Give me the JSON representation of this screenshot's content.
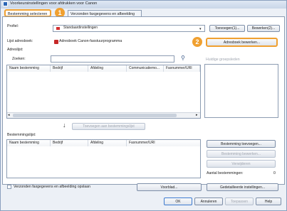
{
  "window": {
    "title": "Voorkeursinstellingen voor afdrukken voor Canon"
  },
  "tabs": [
    {
      "label": "Bestemming selecteren"
    },
    {
      "label": "Verzonden faxgegevens en afbeelding"
    }
  ],
  "callouts": {
    "one": "1",
    "two": "2"
  },
  "profile": {
    "label": "Profiel:",
    "value": "Standaardinstellingen",
    "add_button": "Toevoegen(1)...",
    "edit_button": "Bewerken(2)..."
  },
  "addressbook": {
    "list_label": "Lijst adresboek:",
    "value": "Adresboek Canon-faxstuurprogramma",
    "edit_button": "Adresboek bewerken...",
    "address_list_label": "Adreslijst:",
    "search_label": "Zoeken:",
    "search_value": "",
    "groups_label": "Huidige groepsleden"
  },
  "address_columns": [
    "Naam bestemming",
    "Bedrijf",
    "Afdeling",
    "Communicatiemo...",
    "Faxnummer/URI"
  ],
  "add_to_list_button": "Toevoegen aan bestemmingslijst",
  "destlist": {
    "label": "Bestemmingslijst:",
    "columns": [
      "Naam bestemming",
      "Bedrijf",
      "Afdeling",
      "Faxnummer/URI"
    ]
  },
  "right_buttons": {
    "add": "Bestemming toevoegen...",
    "edit": "Bestemming bewerken...",
    "delete": "Verwijderen"
  },
  "count": {
    "label": "Aantal bestemmingen:",
    "value": "0"
  },
  "save_checkbox_label": "Verzonden faxgegevens en afbeelding opslaan",
  "preview_button": "Voorblad...",
  "detail_button": "Gedetailleerde instellingen...",
  "footer": {
    "ok": "OK",
    "cancel": "Annuleren",
    "apply": "Toepassen",
    "help": "Help"
  }
}
